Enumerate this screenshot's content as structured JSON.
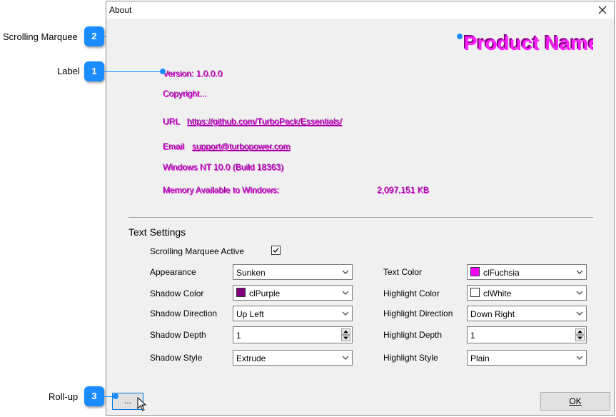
{
  "window": {
    "title": "About"
  },
  "about": {
    "marquee_text": "Product Name",
    "version": "Version: 1.0.0.0",
    "copyright": "Copyright...",
    "url_label": "URL",
    "url_value": "https://github.com/TurboPack/Essentials/",
    "email_label": "Email",
    "email_value": "support@turbopower.com",
    "os": "Windows NT 10.0 (Build 18363)",
    "memory_label": "Memory Available to Windows:",
    "memory_value": "2,097,151 KB"
  },
  "settings": {
    "title": "Text Settings",
    "marquee_active_label": "Scrolling Marquee Active",
    "marquee_active": true,
    "appearance_label": "Appearance",
    "appearance_value": "Sunken",
    "shadow_color_label": "Shadow Color",
    "shadow_color_value": "clPurple",
    "shadow_color_hex": "#800080",
    "shadow_direction_label": "Shadow Direction",
    "shadow_direction_value": "Up Left",
    "shadow_depth_label": "Shadow Depth",
    "shadow_depth_value": "1",
    "shadow_style_label": "Shadow Style",
    "shadow_style_value": "Extrude",
    "text_color_label": "Text Color",
    "text_color_value": "clFuchsia",
    "text_color_hex": "#ff00ff",
    "highlight_color_label": "Highlight Color",
    "highlight_color_value": "clWhite",
    "highlight_color_hex": "#ffffff",
    "highlight_direction_label": "Highlight Direction",
    "highlight_direction_value": "Down Right",
    "highlight_depth_label": "Highlight Depth",
    "highlight_depth_value": "1",
    "highlight_style_label": "Highlight Style",
    "highlight_style_value": "Plain"
  },
  "buttons": {
    "rollup_label": "...",
    "ok_label": "OK"
  },
  "callouts": [
    {
      "num": "2",
      "label": "Scrolling Marquee"
    },
    {
      "num": "1",
      "label": "Label"
    },
    {
      "num": "3",
      "label": "Roll-up"
    }
  ],
  "colors": {
    "accent": "#1a8cff",
    "label_text": "#e010e0"
  }
}
